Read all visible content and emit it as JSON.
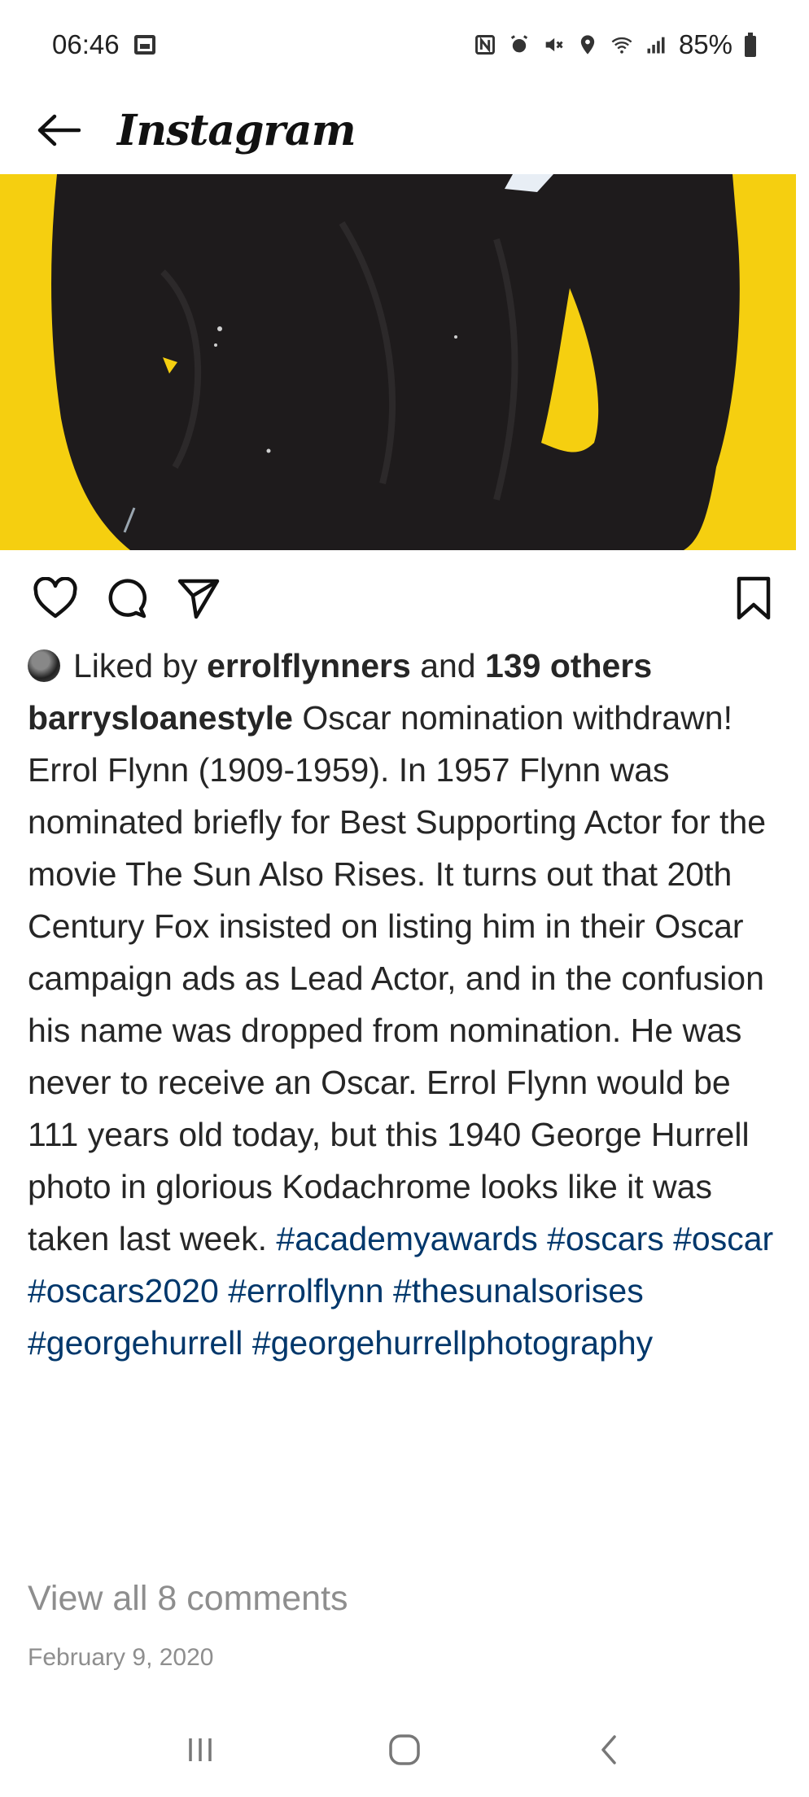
{
  "status_bar": {
    "time": "06:46",
    "battery": "85%"
  },
  "app_bar": {
    "title": "Instagram"
  },
  "post": {
    "likes": {
      "prefix": "Liked by",
      "liker": "errolflynners",
      "middle": "and",
      "others": "139 others"
    },
    "author": "barrysloanestyle",
    "caption_body": "Oscar nomination withdrawn! Errol Flynn (1909-1959). In 1957 Flynn was nominated briefly for Best Supporting Actor for the movie The Sun Also Rises. It turns out that 20th Century Fox insisted on listing him in their Oscar campaign ads as Lead Actor, and in the confusion his name was dropped from nomination. He was never to receive an Oscar. Errol Flynn would be 111 years old today, but this 1940 George Hurrell photo in glorious Kodachrome looks like it was taken last week.",
    "hashtags": [
      "#academyawards",
      "#oscars",
      "#oscar",
      "#oscars2020",
      "#errolflynn",
      "#thesunalsorises",
      "#georgehurrell",
      "#georgehurrellphotography"
    ],
    "comments_link": "View all 8 comments",
    "date": "February 9, 2020"
  },
  "icons": {
    "back": "back-arrow-icon",
    "like": "heart-icon",
    "comment": "comment-icon",
    "share": "paper-plane-icon",
    "save": "bookmark-icon"
  },
  "colors": {
    "photo_background": "#f5cf10",
    "hashtag": "#00376b",
    "muted_text": "#8e8e8e"
  }
}
